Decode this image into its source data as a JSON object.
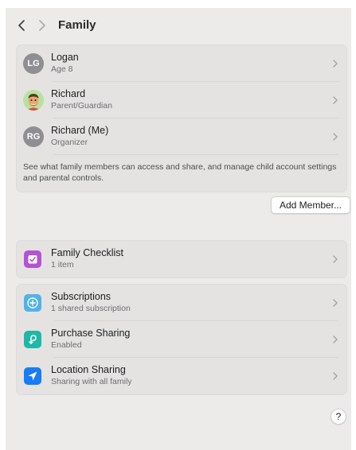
{
  "toolbar": {
    "back_icon": "chevron-left-icon",
    "forward_icon": "chevron-right-icon",
    "title": "Family"
  },
  "members": [
    {
      "initials": "LG",
      "name": "Logan",
      "role": "Age 8",
      "avatar": "initials"
    },
    {
      "initials": "",
      "name": "Richard",
      "role": "Parent/Guardian",
      "avatar": "memoji"
    },
    {
      "initials": "RG",
      "name": "Richard (Me)",
      "role": "Organizer",
      "avatar": "initials"
    }
  ],
  "members_description": "See what family members can access and share, and manage child account settings and parental controls.",
  "add_member_label": "Add Member...",
  "checklist": {
    "title": "Family Checklist",
    "subtitle": "1 item",
    "icon": "checklist-icon",
    "color": "#b453d6"
  },
  "services": [
    {
      "title": "Subscriptions",
      "subtitle": "1 shared subscription",
      "icon": "subscriptions-icon",
      "color": "#4fb3e8"
    },
    {
      "title": "Purchase Sharing",
      "subtitle": "Enabled",
      "icon": "purchase-sharing-icon",
      "color": "#1fb8a6"
    },
    {
      "title": "Location Sharing",
      "subtitle": "Sharing with all family",
      "icon": "location-arrow-icon",
      "color": "#1a7cf5"
    }
  ],
  "help_label": "?"
}
